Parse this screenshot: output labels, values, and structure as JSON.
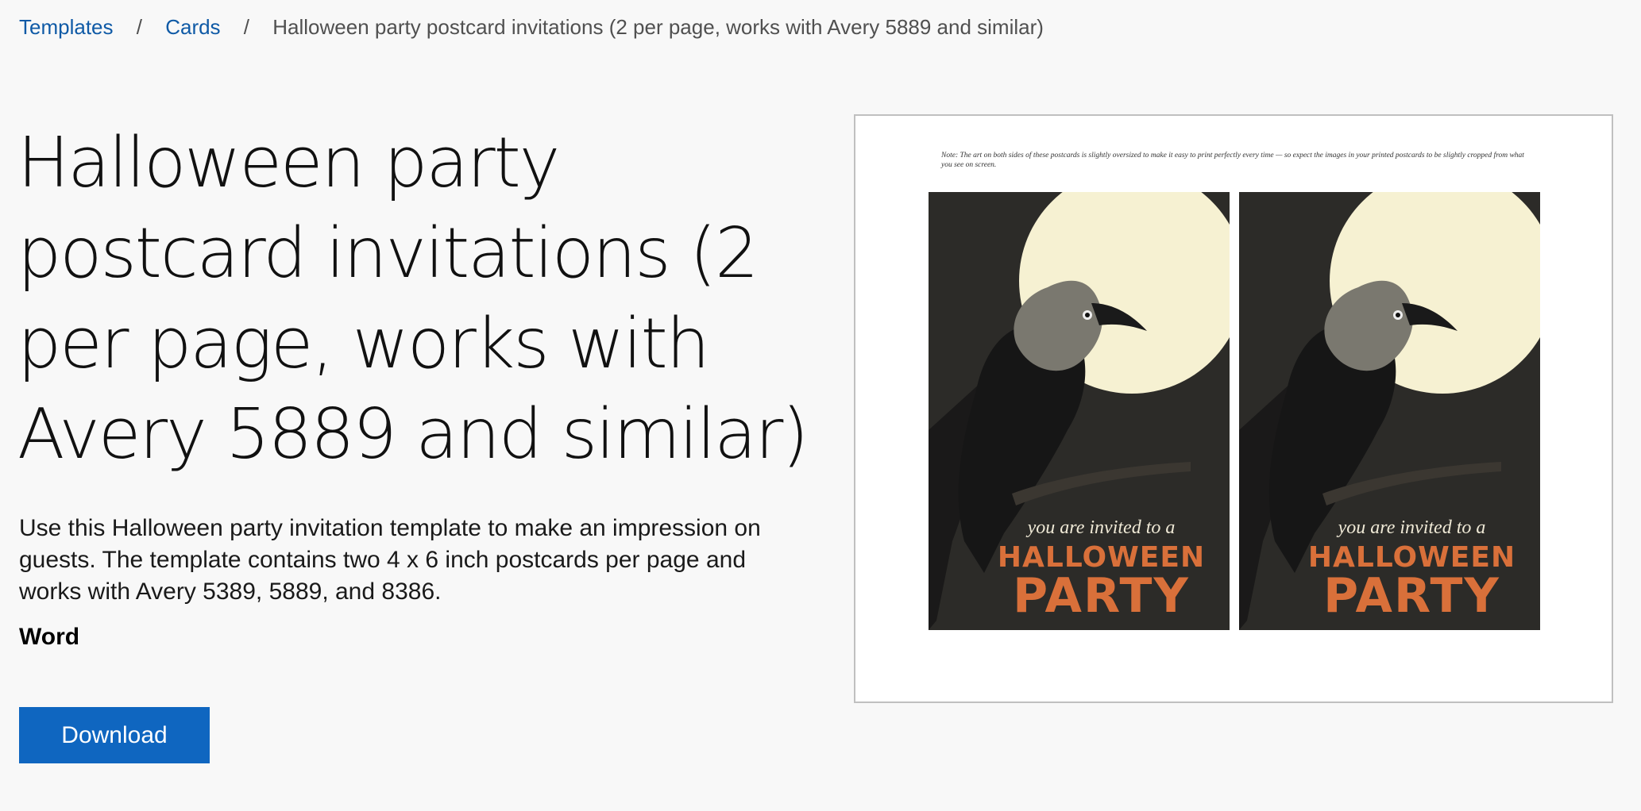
{
  "breadcrumb": {
    "items": [
      "Templates",
      "Cards"
    ],
    "separator": "/",
    "current": "Halloween party postcard invitations (2 per page, works with Avery 5889 and similar)"
  },
  "title": "Halloween party postcard invitations (2 per page, works with Avery 5889 and similar)",
  "description": "Use this Halloween party invitation template to make an impression on guests. The template contains two 4 x 6 inch postcards per page and works with Avery 5389, 5889, and 8386.",
  "app": "Word",
  "download_label": "Download",
  "preview": {
    "note": "Note: The art on both sides of these postcards is slightly oversized to make it easy to print perfectly every time — so expect the images in your printed postcards to be slightly cropped from what you see on screen.",
    "postcards": [
      {
        "invite": "you are invited to a",
        "event_line1": "HALLOWEEN",
        "event_line2": "PARTY"
      },
      {
        "invite": "you are invited to a",
        "event_line1": "HALLOWEEN",
        "event_line2": "PARTY"
      }
    ]
  },
  "colors": {
    "link": "#0f5aa6",
    "button": "#0f66c0",
    "card_background": "#2c2b28",
    "moon": "#f6f1d2",
    "event_text": "#d9703a"
  }
}
